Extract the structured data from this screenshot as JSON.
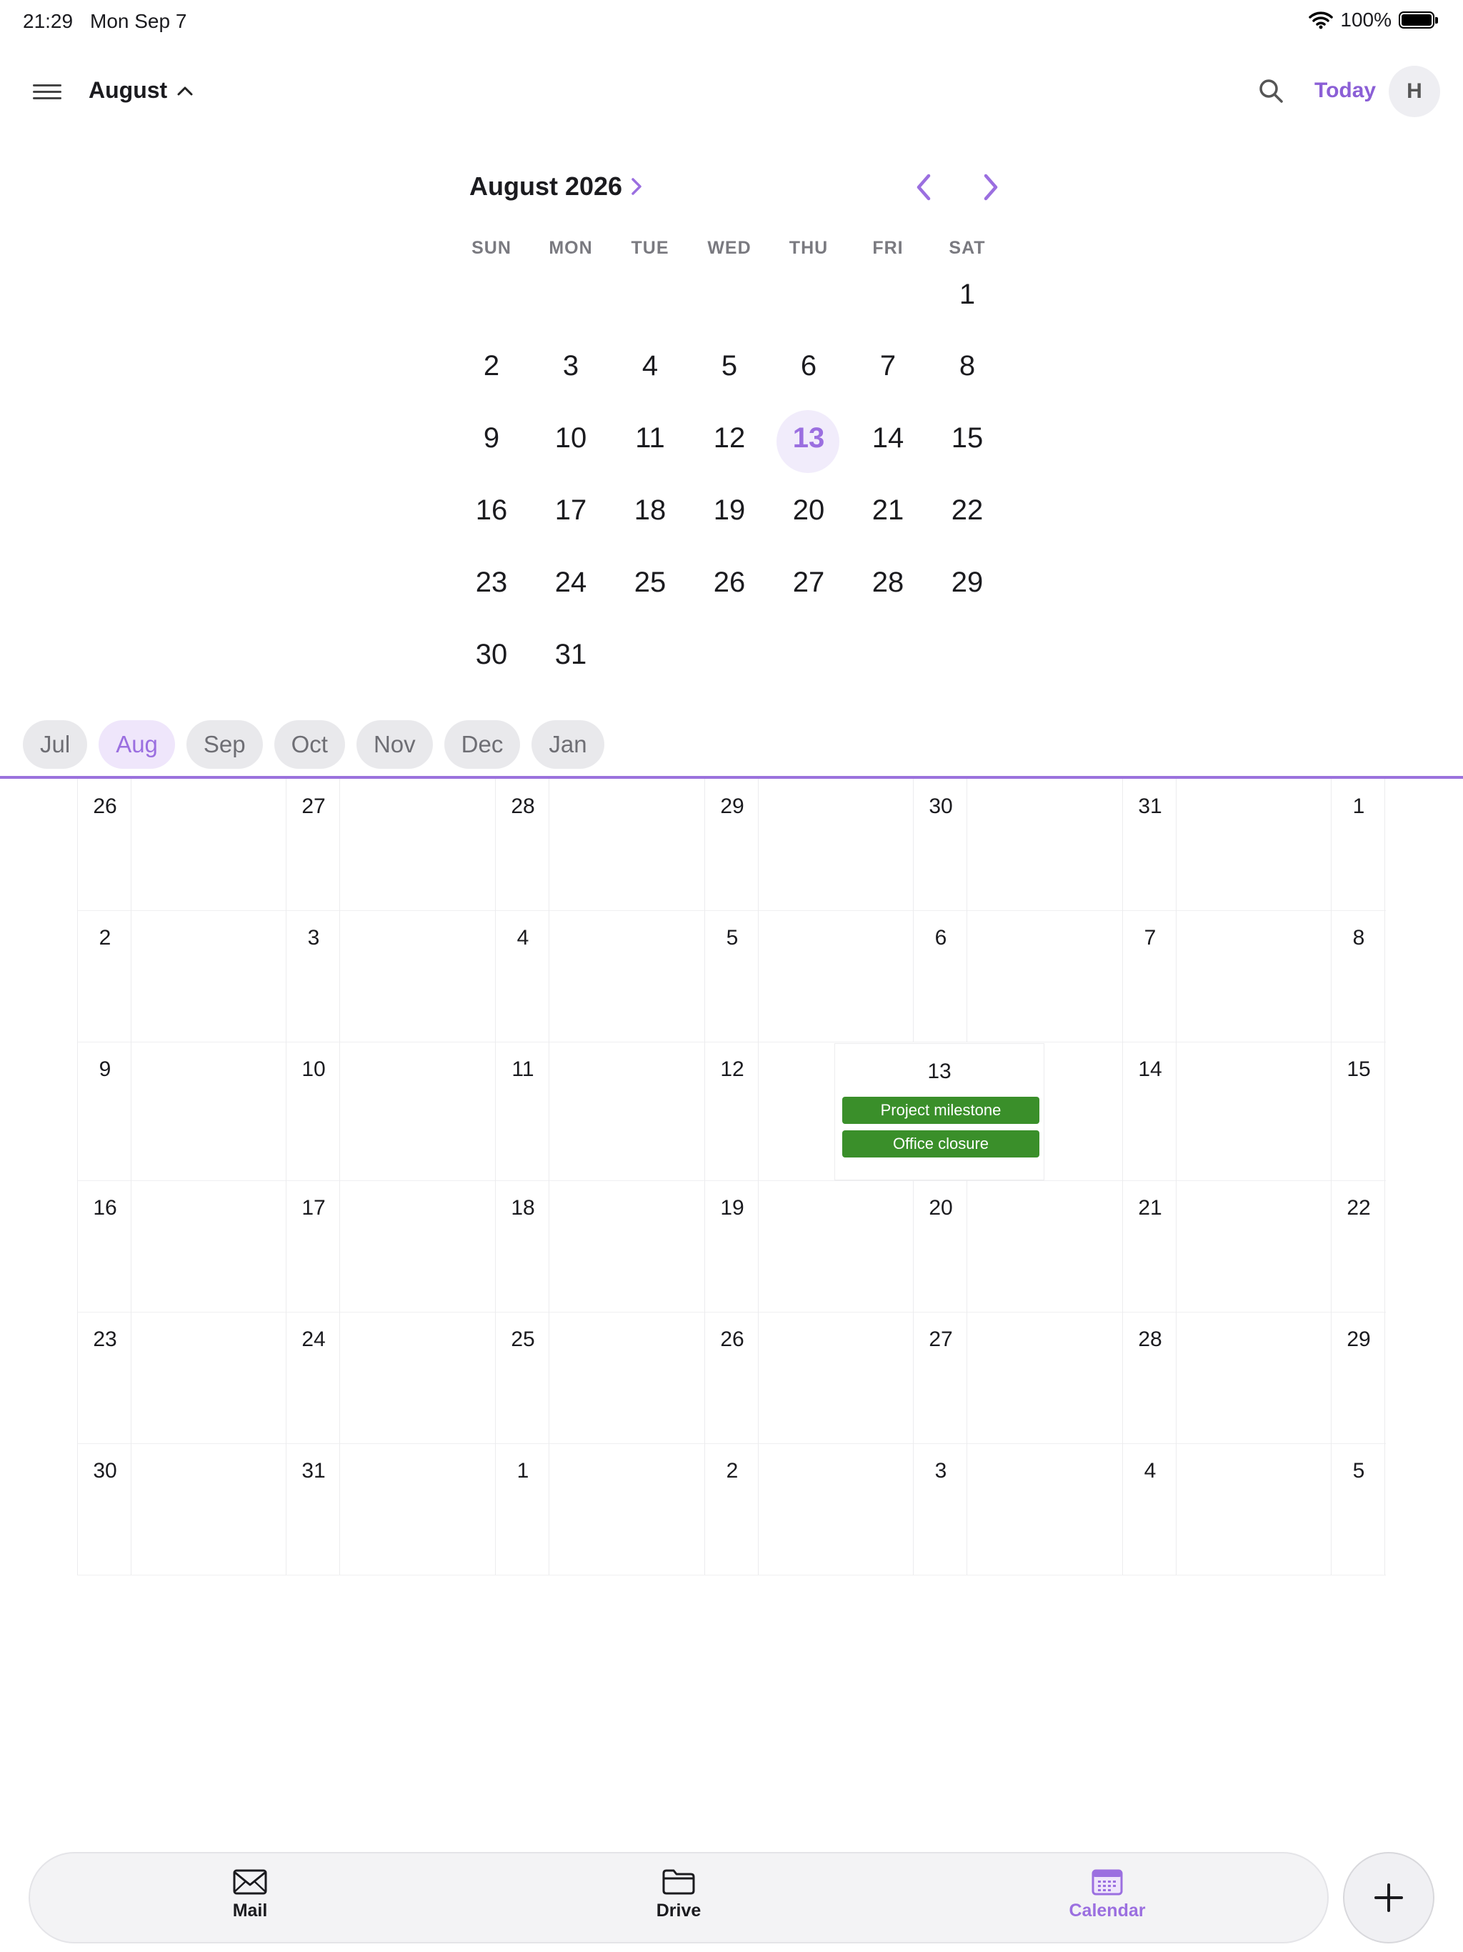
{
  "status_bar": {
    "time": "21:29",
    "date": "Mon Sep 7",
    "battery": "100%"
  },
  "header": {
    "month_label": "August",
    "today_label": "Today",
    "avatar_initial": "H"
  },
  "mini_calendar": {
    "title": "August 2026",
    "weekdays": [
      "SUN",
      "MON",
      "TUE",
      "WED",
      "THU",
      "FRI",
      "SAT"
    ],
    "weeks": [
      [
        "",
        "",
        "",
        "",
        "",
        "",
        "1"
      ],
      [
        "2",
        "3",
        "4",
        "5",
        "6",
        "7",
        "8"
      ],
      [
        "9",
        "10",
        "11",
        "12",
        "13",
        "14",
        "15"
      ],
      [
        "16",
        "17",
        "18",
        "19",
        "20",
        "21",
        "22"
      ],
      [
        "23",
        "24",
        "25",
        "26",
        "27",
        "28",
        "29"
      ],
      [
        "30",
        "31",
        "",
        "",
        "",
        "",
        ""
      ]
    ],
    "selected_day": "13"
  },
  "month_chips": [
    {
      "label": "Jul",
      "active": false
    },
    {
      "label": "Aug",
      "active": true
    },
    {
      "label": "Sep",
      "active": false
    },
    {
      "label": "Oct",
      "active": false
    },
    {
      "label": "Nov",
      "active": false
    },
    {
      "label": "Dec",
      "active": false
    },
    {
      "label": "Jan",
      "active": false
    }
  ],
  "month_grid": {
    "weeks": [
      [
        "26",
        "27",
        "28",
        "29",
        "30",
        "31",
        "1"
      ],
      [
        "2",
        "3",
        "4",
        "5",
        "6",
        "7",
        "8"
      ],
      [
        "9",
        "10",
        "11",
        "12",
        "13",
        "14",
        "15"
      ],
      [
        "16",
        "17",
        "18",
        "19",
        "20",
        "21",
        "22"
      ],
      [
        "23",
        "24",
        "25",
        "26",
        "27",
        "28",
        "29"
      ],
      [
        "30",
        "31",
        "1",
        "2",
        "3",
        "4",
        "5"
      ]
    ],
    "highlighted_day": "13",
    "events": [
      "Project milestone",
      "Office closure"
    ],
    "event_color": "#3a8f2a"
  },
  "tabs": [
    {
      "label": "Mail",
      "icon": "mail-icon",
      "active": false
    },
    {
      "label": "Drive",
      "icon": "folder-icon",
      "active": false
    },
    {
      "label": "Calendar",
      "icon": "calendar-icon",
      "active": true
    }
  ],
  "colors": {
    "accent": "#9b6fe0",
    "event": "#3a8f2a"
  }
}
